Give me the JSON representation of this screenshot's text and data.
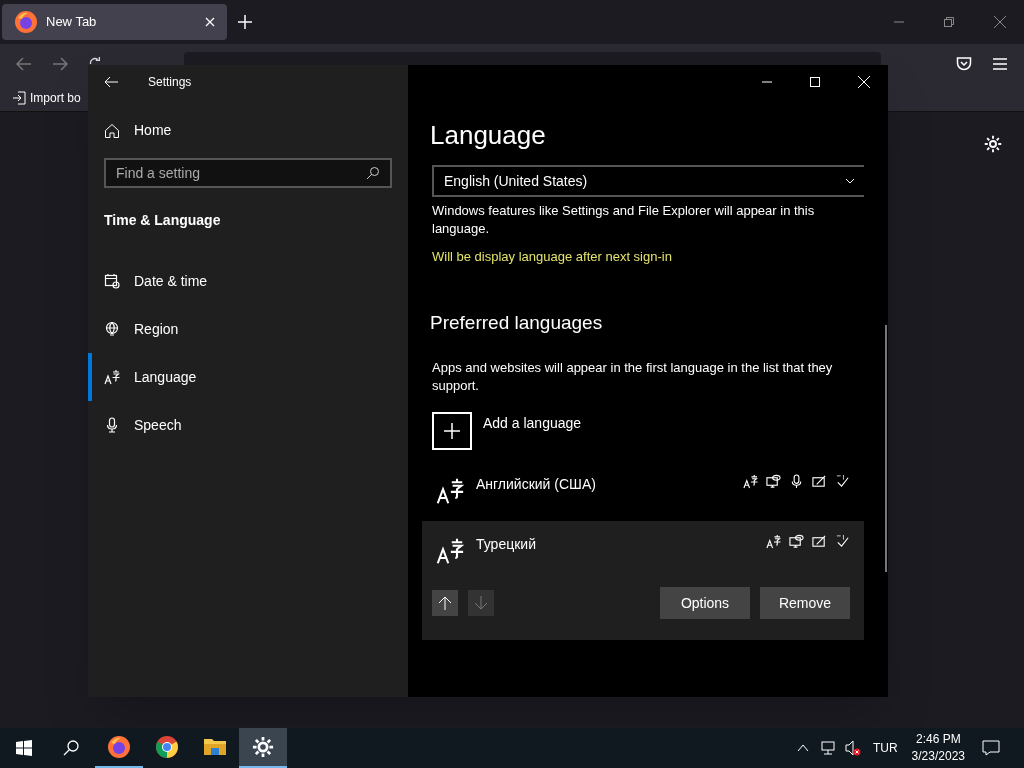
{
  "browser": {
    "tab": {
      "title": "New Tab"
    },
    "bookmark": "Import bo"
  },
  "settings": {
    "title": "Settings",
    "sidebar": {
      "home": "Home",
      "search_placeholder": "Find a setting",
      "section": "Time & Language",
      "items": [
        {
          "label": "Date & time",
          "kind": "calendar",
          "selected": false
        },
        {
          "label": "Region",
          "kind": "globe",
          "selected": false
        },
        {
          "label": "Language",
          "kind": "language",
          "selected": true
        },
        {
          "label": "Speech",
          "kind": "mic",
          "selected": false
        }
      ]
    },
    "page": {
      "title": "Language",
      "display_language": "English (United States)",
      "display_note": "Windows features like Settings and File Explorer will appear in this language.",
      "pending_note": "Will be display language after next sign-in",
      "preferred_title": "Preferred languages",
      "preferred_note": "Apps and websites will appear in the first language in the list that they support.",
      "add_label": "Add a language",
      "languages": [
        {
          "name": "Английский (США)",
          "speech": true,
          "selected": false
        },
        {
          "name": "Турецкий",
          "speech": false,
          "selected": true
        }
      ],
      "move_up_disabled": false,
      "move_down_disabled": true,
      "buttons": [
        "Options",
        "Remove"
      ]
    }
  },
  "taskbar": {
    "apps": [
      {
        "kind": "firefox",
        "running": true,
        "selected": false
      },
      {
        "kind": "chrome",
        "running": false,
        "selected": false
      },
      {
        "kind": "folder",
        "running": false,
        "selected": false
      },
      {
        "kind": "settings",
        "running": true,
        "selected": true
      }
    ],
    "input_language": "TUR",
    "time": "2:46 PM",
    "date": "3/23/2023"
  }
}
